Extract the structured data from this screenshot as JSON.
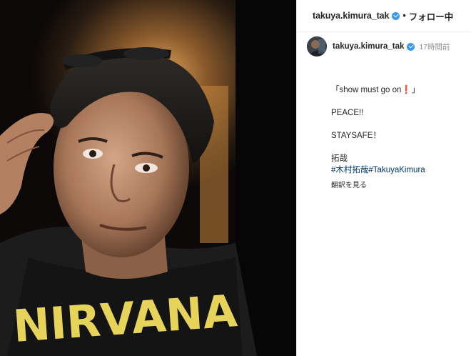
{
  "header": {
    "username": "takuya.kimura_tak",
    "separator": "•",
    "follow_label": "フォロー中"
  },
  "comment": {
    "username": "takuya.kimura_tak",
    "time": "17時間前",
    "caption_lines": [
      "「show must go on❗️」",
      "PEACE!!",
      "STAYSAFE！",
      "拓哉"
    ],
    "hashtags": [
      "#木村拓哉",
      "#TakuyaKimura"
    ],
    "translate_label": "翻訳を見る"
  },
  "photo": {
    "shirt_text": "NIRVANA"
  },
  "colors": {
    "verified": "#3897f0",
    "hashtag": "#00376b",
    "muted": "#8e8e8e",
    "shirt_print": "#e6d35a"
  },
  "icons": [
    "verified-badge-icon"
  ]
}
